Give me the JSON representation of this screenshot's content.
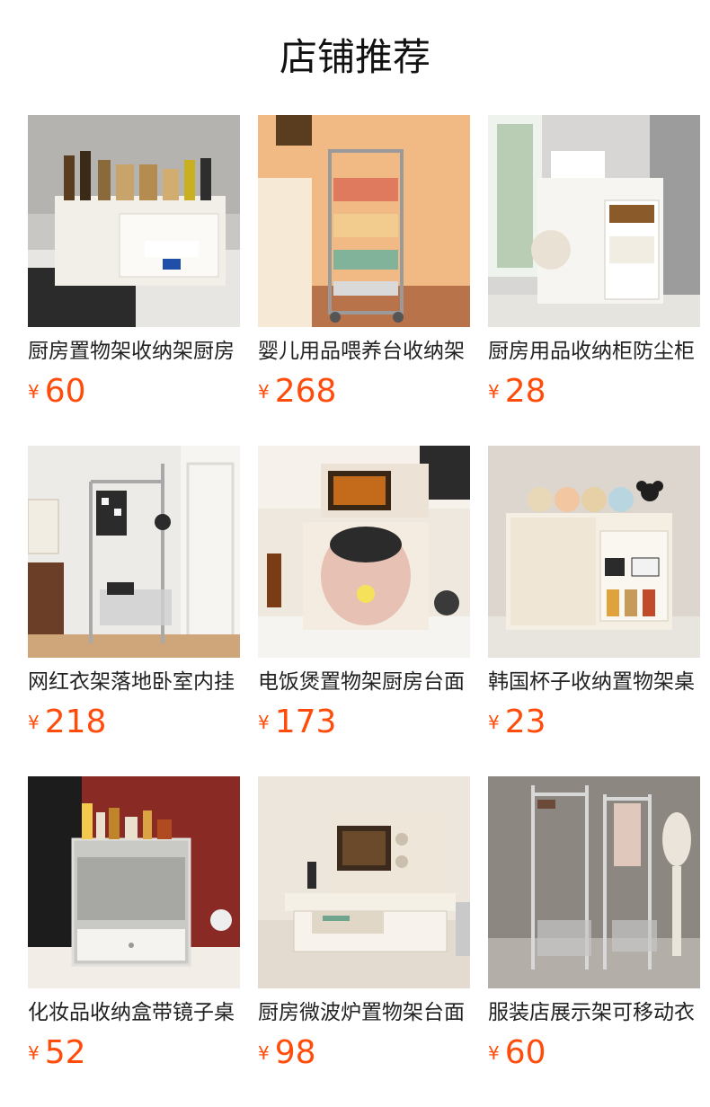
{
  "section": {
    "title": "店铺推荐"
  },
  "currency_symbol": "¥",
  "accent_color": "#ff4c0a",
  "products": [
    {
      "name": "厨房置物架收纳架厨房",
      "price": "60"
    },
    {
      "name": "婴儿用品喂养台收纳架",
      "price": "268"
    },
    {
      "name": "厨房用品收纳柜防尘柜",
      "price": "28"
    },
    {
      "name": "网红衣架落地卧室内挂",
      "price": "218"
    },
    {
      "name": "电饭煲置物架厨房台面",
      "price": "173"
    },
    {
      "name": "韩国杯子收纳置物架桌",
      "price": "23"
    },
    {
      "name": "化妆品收纳盒带镜子桌",
      "price": "52"
    },
    {
      "name": "厨房微波炉置物架台面",
      "price": "98"
    },
    {
      "name": "服装店展示架可移动衣",
      "price": "60"
    }
  ]
}
